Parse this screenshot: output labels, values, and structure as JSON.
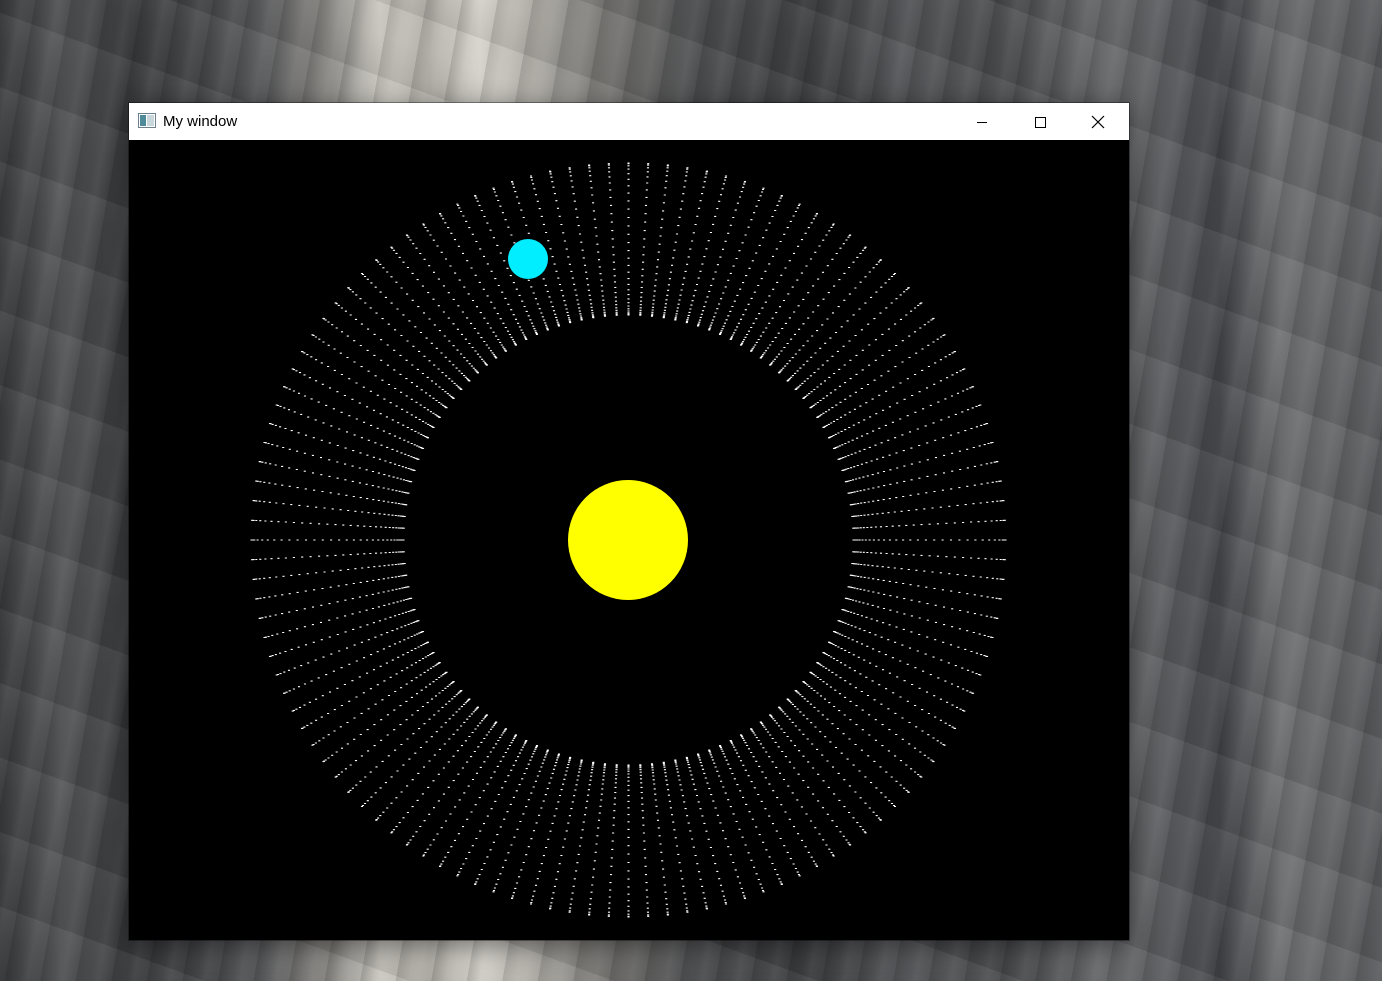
{
  "window": {
    "title": "My window",
    "controls": {
      "minimize": "minimize-icon",
      "maximize": "maximize-icon",
      "close": "close-icon"
    }
  },
  "scene": {
    "background_color": "#000000",
    "sun_color": "#ffff00",
    "planet_color": "#00eeff",
    "trail_color": "#ffffff"
  }
}
